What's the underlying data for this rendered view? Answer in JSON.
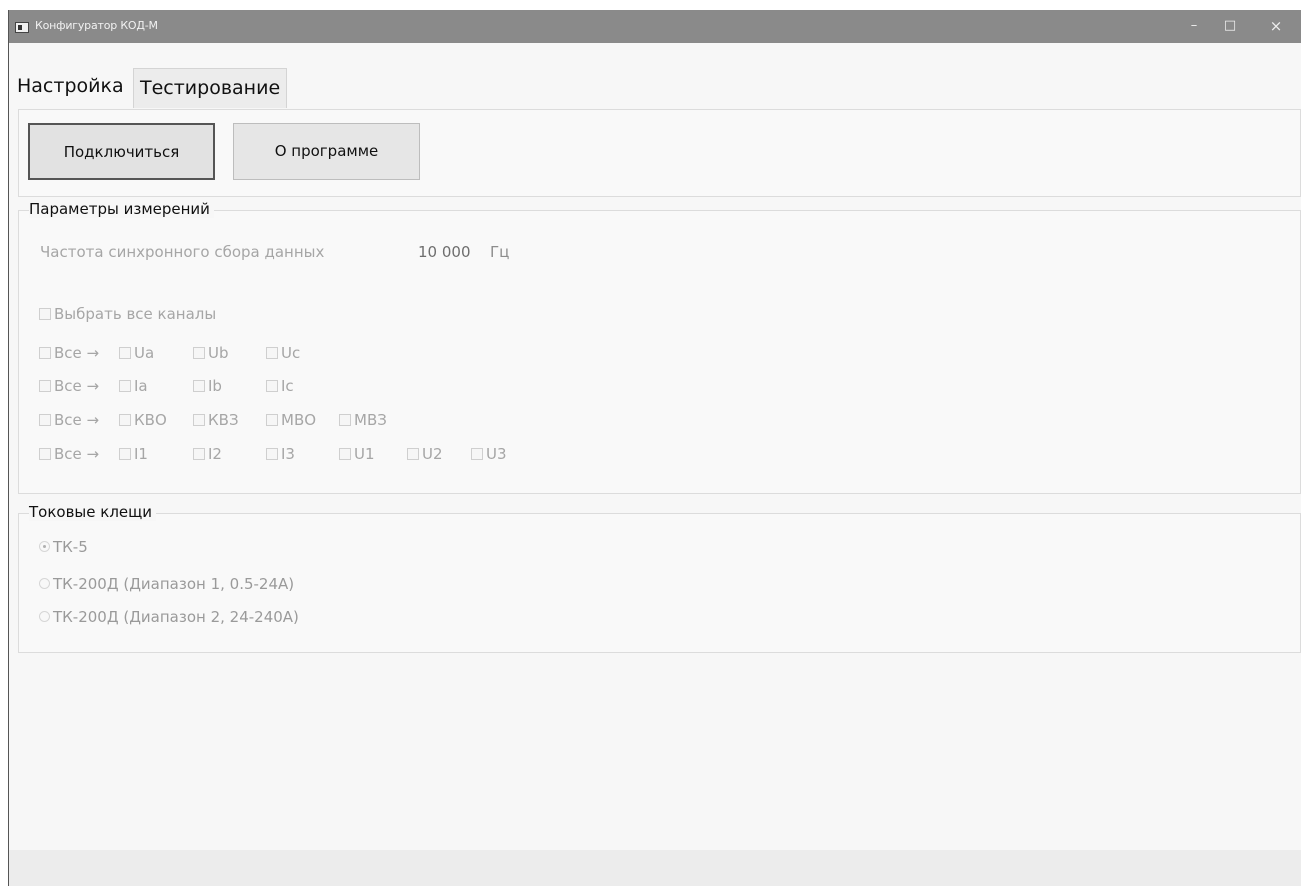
{
  "window": {
    "title": "Конфигуратор КОД-М",
    "minimize": "–",
    "maximize": "□",
    "close": "×"
  },
  "tabs": [
    {
      "label": "Настройка",
      "active": true
    },
    {
      "label": "Тестирование",
      "active": false
    }
  ],
  "toolbar": {
    "connect_label": "Подключиться",
    "about_label": "О программе"
  },
  "measurement": {
    "title": "Параметры измерений",
    "frequency_label": "Частота синхронного сбора данных",
    "frequency_value": "10 000",
    "frequency_unit": "Гц",
    "select_all_label": "Выбрать все каналы",
    "rows": [
      {
        "all_label": "Все →",
        "channels": [
          "Ua",
          "Ub",
          "Uc"
        ]
      },
      {
        "all_label": "Все →",
        "channels": [
          "Ia",
          "Ib",
          "Ic"
        ]
      },
      {
        "all_label": "Все →",
        "channels": [
          "КВО",
          "КВЗ",
          "МВО",
          "МВЗ"
        ]
      },
      {
        "all_label": "Все →",
        "channels": [
          "I1",
          "I2",
          "I3",
          "U1",
          "U2",
          "U3"
        ]
      }
    ]
  },
  "clamps": {
    "title": "Токовые клещи",
    "options": [
      {
        "label": "ТК-5",
        "selected": true
      },
      {
        "label": "ТК-200Д (Диапазон 1, 0.5-24А)",
        "selected": false
      },
      {
        "label": "ТК-200Д (Диапазон 2, 24-240А)",
        "selected": false
      }
    ]
  }
}
